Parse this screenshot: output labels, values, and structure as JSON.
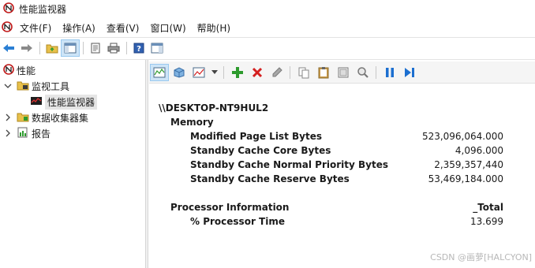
{
  "window": {
    "title": "性能监视器"
  },
  "menubar": {
    "items": [
      {
        "label": "文件(F)"
      },
      {
        "label": "操作(A)"
      },
      {
        "label": "查看(V)"
      },
      {
        "label": "窗口(W)"
      },
      {
        "label": "帮助(H)"
      }
    ]
  },
  "tree": {
    "root": "性能",
    "monitoring_tools": "监视工具",
    "performance_monitor": "性能监视器",
    "data_collector_sets": "数据收集器集",
    "reports": "报告"
  },
  "report": {
    "computer": "\\\\DESKTOP-NT9HUL2",
    "memory": {
      "section": "Memory",
      "counters": [
        {
          "name": "Modified Page List Bytes",
          "value": "523,096,064.000"
        },
        {
          "name": "Standby Cache Core Bytes",
          "value": "4,096.000"
        },
        {
          "name": "Standby Cache Normal Priority Bytes",
          "value": "2,359,357,440"
        },
        {
          "name": "Standby Cache Reserve Bytes",
          "value": "53,469,184.000"
        }
      ]
    },
    "processor": {
      "section": "Processor Information",
      "instance": "_Total",
      "counters": [
        {
          "name": "% Processor Time",
          "value": "13.699"
        }
      ]
    }
  },
  "watermark": "CSDN @画萝[HALCYON]",
  "colors": {
    "accent_green": "#2e9b2e",
    "delete_red": "#d42020",
    "pause_blue": "#1c6fd0",
    "selection_bg": "#e5e5e5"
  }
}
